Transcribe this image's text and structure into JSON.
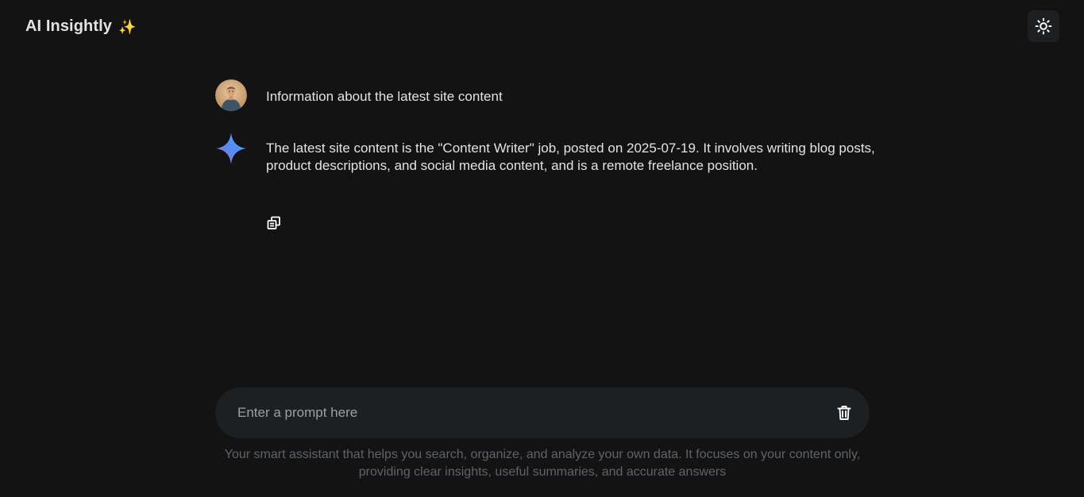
{
  "app": {
    "title": "AI Insightly",
    "title_icon": "sparkles-emoji",
    "title_sparkle": "✨"
  },
  "header": {
    "theme_toggle_icon": "sun-icon"
  },
  "conversation": {
    "user_message": {
      "avatar": "user-avatar",
      "text": "Information about the latest site content"
    },
    "ai_message": {
      "icon": "gemini-sparkle-icon",
      "text": "The latest site content is the \"Content Writer\" job, posted on 2025-07-19. It involves writing blog posts, product descriptions, and social media content, and is a remote freelance position.",
      "action_icon": "copy-icon"
    }
  },
  "prompt": {
    "value": "",
    "placeholder": "Enter a prompt here",
    "clear_icon": "trash-icon"
  },
  "footer": {
    "note": "Your smart assistant that helps you search, organize, and analyze your own data. It focuses on your content only, providing clear insights, useful summaries, and accurate answers"
  },
  "colors": {
    "background": "#131314",
    "surface": "#1e1f20",
    "text": "#e3e3e3",
    "muted": "#5f6368",
    "placeholder": "#9aa0a6",
    "gemini_blue": "#4f8ef7",
    "gemini_purple": "#9b72cb"
  }
}
